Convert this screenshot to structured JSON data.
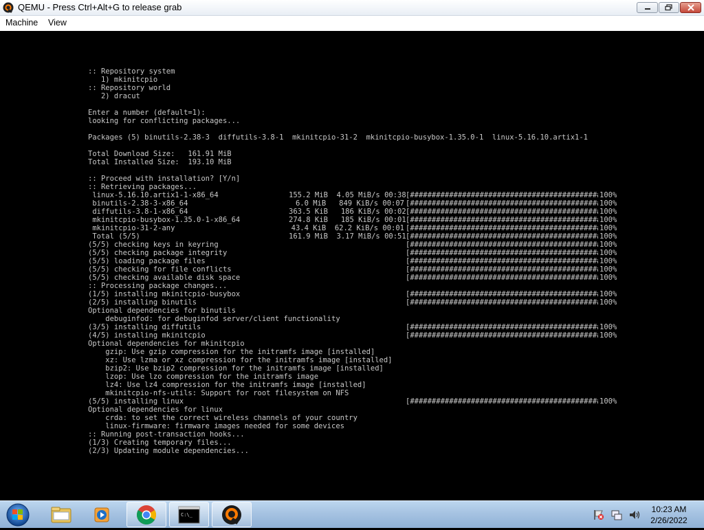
{
  "window": {
    "title": "QEMU - Press Ctrl+Alt+G to release grab",
    "logo_icon": "qemu-logo-icon",
    "controls": [
      "minimize-icon",
      "maximize-icon",
      "close-icon"
    ]
  },
  "menu": [
    "Machine",
    "View"
  ],
  "terminal": {
    "lines": [
      {
        "text": ":: Repository system"
      },
      {
        "text": "   1) mkinitcpio"
      },
      {
        "text": ":: Repository world"
      },
      {
        "text": "   2) dracut"
      },
      {
        "text": ""
      },
      {
        "text": "Enter a number (default=1):"
      },
      {
        "text": "looking for conflicting packages..."
      },
      {
        "text": ""
      },
      {
        "text": "Packages (5) binutils-2.38-3  diffutils-3.8-1  mkinitcpio-31-2  mkinitcpio-busybox-1.35.0-1  linux-5.16.10.artix1-1"
      },
      {
        "text": ""
      },
      {
        "text": "Total Download Size:   161.91 MiB"
      },
      {
        "text": "Total Installed Size:  193.10 MiB"
      },
      {
        "text": ""
      },
      {
        "text": ":: Proceed with installation? [Y/n]"
      },
      {
        "text": ":: Retrieving packages..."
      },
      {
        "text": " linux-5.16.10.artix1-1-x86_64",
        "stats": "155.2 MiB  4.05 MiB/s 00:38",
        "bar": "[######################################################]",
        "pct": "100%"
      },
      {
        "text": " binutils-2.38-3-x86_64",
        "stats": "6.0 MiB   849 KiB/s 00:07",
        "bar": "[######################################################]",
        "pct": "100%"
      },
      {
        "text": " diffutils-3.8-1-x86_64",
        "stats": "363.5 KiB   186 KiB/s 00:02",
        "bar": "[######################################################]",
        "pct": "100%"
      },
      {
        "text": " mkinitcpio-busybox-1.35.0-1-x86_64",
        "stats": "274.8 KiB   185 KiB/s 00:01",
        "bar": "[######################################################]",
        "pct": "100%"
      },
      {
        "text": " mkinitcpio-31-2-any",
        "stats": "43.4 KiB  62.2 KiB/s 00:01",
        "bar": "[######################################################]",
        "pct": "100%"
      },
      {
        "text": " Total (5/5)",
        "stats": "161.9 MiB  3.17 MiB/s 00:51",
        "bar": "[######################################################]",
        "pct": "100%"
      },
      {
        "text": "(5/5) checking keys in keyring",
        "bar": "[######################################################]",
        "pct": "100%"
      },
      {
        "text": "(5/5) checking package integrity",
        "bar": "[######################################################]",
        "pct": "100%"
      },
      {
        "text": "(5/5) loading package files",
        "bar": "[######################################################]",
        "pct": "100%"
      },
      {
        "text": "(5/5) checking for file conflicts",
        "bar": "[######################################################]",
        "pct": "100%"
      },
      {
        "text": "(5/5) checking available disk space",
        "bar": "[######################################################]",
        "pct": "100%"
      },
      {
        "text": ":: Processing package changes..."
      },
      {
        "text": "(1/5) installing mkinitcpio-busybox",
        "bar": "[######################################################]",
        "pct": "100%"
      },
      {
        "text": "(2/5) installing binutils",
        "bar": "[######################################################]",
        "pct": "100%"
      },
      {
        "text": "Optional dependencies for binutils"
      },
      {
        "text": "    debuginfod: for debuginfod server/client functionality"
      },
      {
        "text": "(3/5) installing diffutils",
        "bar": "[######################################################]",
        "pct": "100%"
      },
      {
        "text": "(4/5) installing mkinitcpio",
        "bar": "[######################################################]",
        "pct": "100%"
      },
      {
        "text": "Optional dependencies for mkinitcpio"
      },
      {
        "text": "    gzip: Use gzip compression for the initramfs image [installed]"
      },
      {
        "text": "    xz: Use lzma or xz compression for the initramfs image [installed]"
      },
      {
        "text": "    bzip2: Use bzip2 compression for the initramfs image [installed]"
      },
      {
        "text": "    lzop: Use lzo compression for the initramfs image"
      },
      {
        "text": "    lz4: Use lz4 compression for the initramfs image [installed]"
      },
      {
        "text": "    mkinitcpio-nfs-utils: Support for root filesystem on NFS"
      },
      {
        "text": "(5/5) installing linux",
        "bar": "[######################################################]",
        "pct": "100%"
      },
      {
        "text": "Optional dependencies for linux"
      },
      {
        "text": "    crda: to set the correct wireless channels of your country"
      },
      {
        "text": "    linux-firmware: firmware images needed for some devices"
      },
      {
        "text": ":: Running post-transaction hooks..."
      },
      {
        "text": "(1/3) Creating temporary files..."
      },
      {
        "text": "(2/3) Updating module dependencies..."
      }
    ]
  },
  "taskbar": {
    "start_icon": "windows-start-icon",
    "pinned": [
      {
        "name": "file-explorer-icon",
        "active": false
      },
      {
        "name": "media-player-icon",
        "active": false
      },
      {
        "name": "chrome-icon",
        "active": true
      },
      {
        "name": "command-prompt-icon",
        "active": true
      },
      {
        "name": "qemu-icon",
        "active": true
      }
    ],
    "tray_icons": [
      "action-center-flag-icon",
      "network-icon",
      "volume-icon"
    ],
    "clock": {
      "time": "10:23 AM",
      "date": "2/26/2022"
    }
  },
  "colors": {
    "terminal_bg": "#000000",
    "terminal_fg": "#c8c8c8",
    "taskbar_bg": "#a6c3e2",
    "close_button": "#c4493a"
  }
}
